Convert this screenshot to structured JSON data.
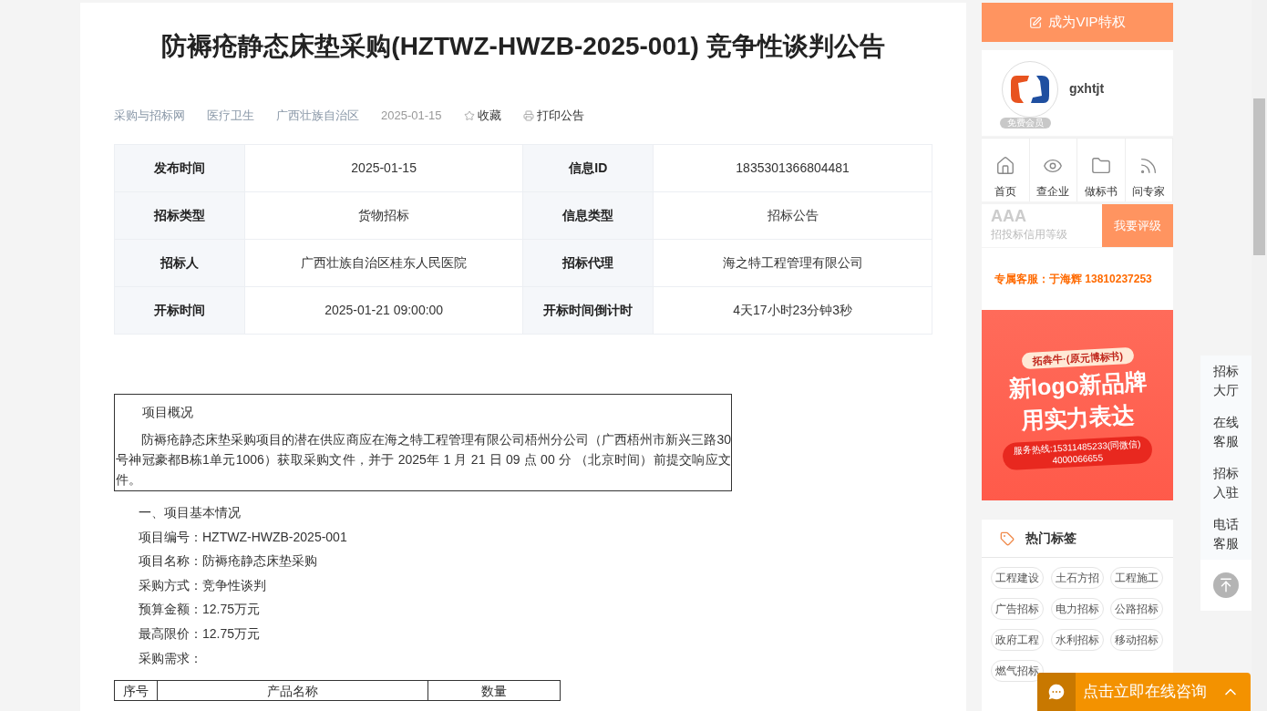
{
  "article": {
    "title": "防褥疮静态床垫采购(HZTWZ-HWZB-2025-001) 竞争性谈判公告",
    "meta": {
      "breadcrumbs": [
        "采购与招标网",
        "医疗卫生",
        "广西壮族自治区"
      ],
      "date": "2025-01-15",
      "favorite": "收藏",
      "print": "打印公告"
    },
    "info_table": [
      [
        {
          "label": "发布时间",
          "value": "2025-01-15"
        },
        {
          "label": "信息ID",
          "value": "1835301366804481"
        }
      ],
      [
        {
          "label": "招标类型",
          "value": "货物招标"
        },
        {
          "label": "信息类型",
          "value": "招标公告"
        }
      ],
      [
        {
          "label": "招标人",
          "value": "广西壮族自治区桂东人民医院"
        },
        {
          "label": "招标代理",
          "value": "海之特工程管理有限公司"
        }
      ],
      [
        {
          "label": "开标时间",
          "value": "2025-01-21 09:00:00"
        },
        {
          "label": "开标时间倒计时",
          "value": "4天17小时23分钟3秒"
        }
      ]
    ],
    "overview": {
      "heading": "项目概况",
      "text": "防褥疮静态床垫采购项目的潜在供应商应在海之特工程管理有限公司梧州分公司（广西梧州市新兴三路30号神冠豪都B栋1单元1006）获取采购文件，并于 2025年 1 月 21 日 09 点 00 分 （北京时间）前提交响应文件。"
    },
    "lines": [
      "一、项目基本情况",
      "项目编号：HZTWZ-HWZB-2025-001",
      "项目名称：防褥疮静态床垫采购",
      "采购方式：竞争性谈判",
      "预算金额：12.75万元",
      "最高限价：12.75万元",
      "采购需求："
    ],
    "product_table": {
      "columns": [
        "序号",
        "产品名称",
        "数量"
      ]
    }
  },
  "sidebar": {
    "vip_button": "成为VIP特权",
    "profile": {
      "name": "gxhtjt",
      "badge": "免费会员"
    },
    "quick_links": [
      {
        "kind": "home",
        "label": "首页"
      },
      {
        "kind": "eye",
        "label": "查企业"
      },
      {
        "kind": "folder",
        "label": "做标书"
      },
      {
        "kind": "signal",
        "label": "问专家"
      }
    ],
    "rating": {
      "grade": "AAA",
      "caption": "招投标信用等级",
      "button": "我要评级"
    },
    "service": "专属客服：于海辉 13810237253",
    "banner": {
      "tag": "拓犇牛·(原元博标书)",
      "headline": [
        "新logo新品牌",
        "用实力表达"
      ],
      "hotline": "服务热线:15311485233(同微信)",
      "phone": "4000066655"
    },
    "hot_tags": {
      "title": "热门标签",
      "tags": [
        "工程建设",
        "土石方招",
        "工程施工",
        "广告招标",
        "电力招标",
        "公路招标",
        "政府工程",
        "水利招标",
        "移动招标",
        "燃气招标"
      ]
    }
  },
  "float_nav": [
    "招标大厅",
    "在线客服",
    "招标入驻",
    "电话客服"
  ],
  "chat_bar": {
    "label": "点击立即在线咨询"
  }
}
